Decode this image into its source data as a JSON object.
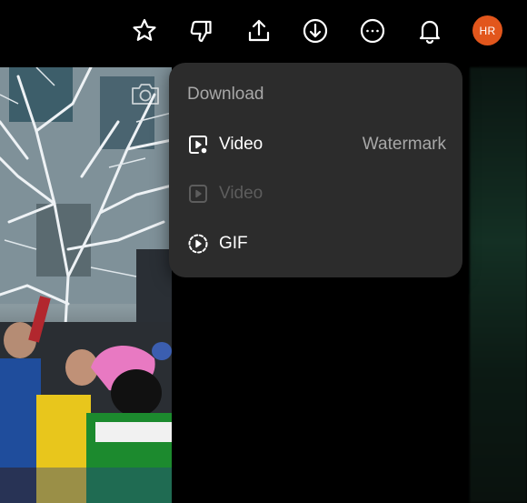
{
  "toolbar": {
    "items": [
      "favorite-icon",
      "dislike-icon",
      "share-icon",
      "download-icon",
      "more-icon",
      "notifications-icon"
    ],
    "avatar_initials": "HR",
    "avatar_color": "#e2561c"
  },
  "download_menu": {
    "title": "Download",
    "items": [
      {
        "label": "Video",
        "right": "Watermark",
        "icon": "video-download-icon",
        "enabled": true
      },
      {
        "label": "Video",
        "right": "",
        "icon": "video-play-icon",
        "enabled": false
      },
      {
        "label": "GIF",
        "right": "",
        "icon": "gif-icon",
        "enabled": true
      }
    ]
  },
  "colors": {
    "menu_bg": "#2c2c2c",
    "muted_text": "#a8a8a8",
    "disabled_text": "#5d5d5d"
  }
}
